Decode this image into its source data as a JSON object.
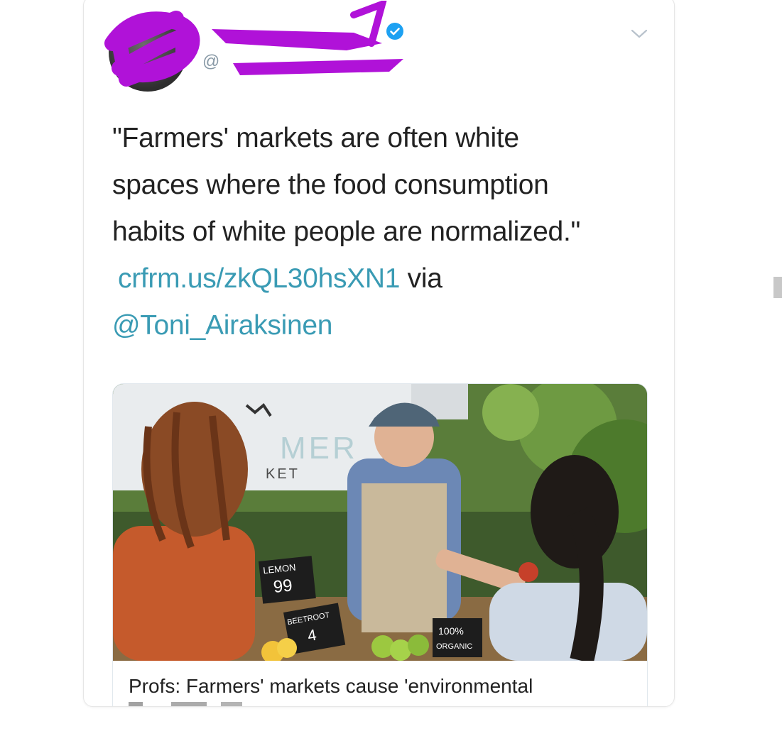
{
  "tweet": {
    "author_handle_prefix": "@",
    "text_lines": [
      "\"Farmers' markets are often white",
      "spaces where the food consumption",
      "habits of white people are normalized.\""
    ],
    "link": "crfrm.us/zkQL30hsXN1",
    "via_word": "via",
    "mention": "@Toni_Airaksinen"
  },
  "card": {
    "title": "Profs: Farmers' markets cause 'environmental",
    "image_signs": {
      "banner_text_1": "MER",
      "banner_text_2": "KET",
      "lemon_label": "LEMON",
      "lemon_price": "99",
      "beetroot_label": "BEETROOT",
      "beetroot_price": "4",
      "organic_line1": "100%",
      "organic_line2": "ORGANIC"
    }
  },
  "colors": {
    "link": "#3a9bb4",
    "verified": "#1da1f2",
    "scribble": "#b012d8"
  },
  "icons": {
    "verified": "verified-badge-icon",
    "chevron": "chevron-down-icon"
  }
}
